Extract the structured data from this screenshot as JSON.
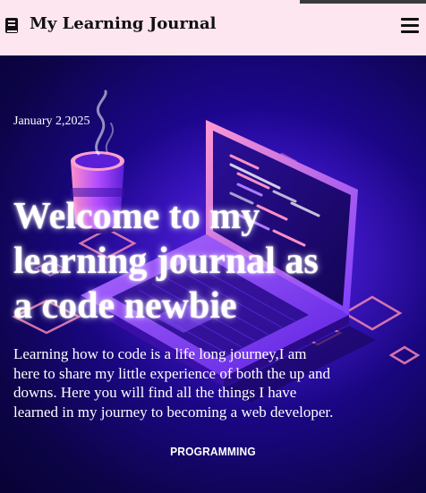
{
  "header": {
    "title": "My Learning Journal",
    "logo_icon": "book-icon",
    "menu_icon": "hamburger-menu-icon",
    "background": "#fde6ef"
  },
  "hero": {
    "date": "January 2,2025",
    "title": "Welcome to my learning journal as a code newbie",
    "description": "Learning how to code is a life long journey,I am here to share my little experience of both the up and downs. Here you will find all the things I have learned in my journey to becoming a web developer.",
    "tag": "PROGRAMMING",
    "illustration": "isometric-laptop-coffee-cup-illustration",
    "background": "#170678"
  }
}
